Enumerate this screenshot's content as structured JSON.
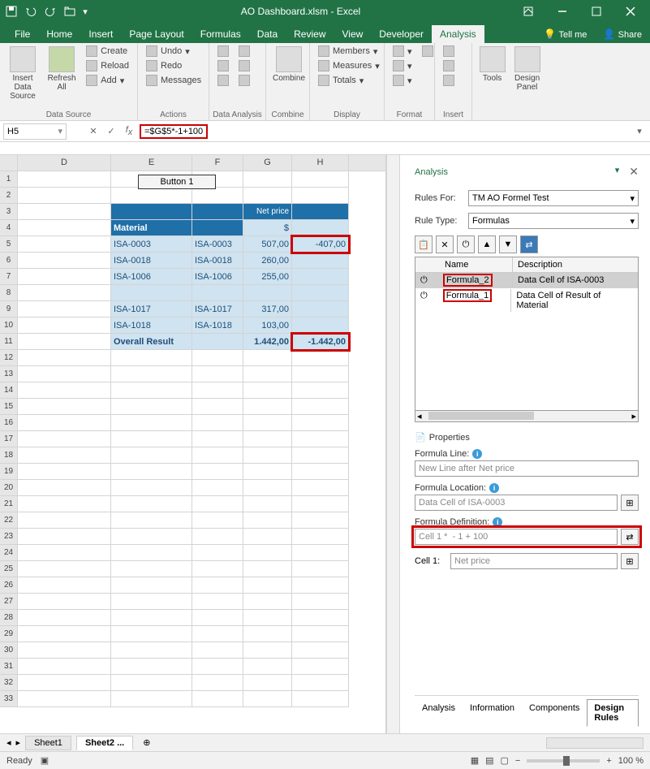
{
  "titlebar": {
    "title": "AO Dashboard.xlsm - Excel"
  },
  "tabs": {
    "file": "File",
    "home": "Home",
    "insert": "Insert",
    "pageLayout": "Page Layout",
    "formulas": "Formulas",
    "data": "Data",
    "review": "Review",
    "view": "View",
    "developer": "Developer",
    "analysis": "Analysis",
    "tellMe": "Tell me",
    "share": "Share"
  },
  "ribbon": {
    "dataSource": {
      "insertDataSource": "Insert Data Source",
      "refreshAll": "Refresh All",
      "create": "Create",
      "reload": "Reload",
      "add": "Add",
      "label": "Data Source"
    },
    "actions": {
      "undo": "Undo",
      "redo": "Redo",
      "messages": "Messages",
      "label": "Actions"
    },
    "dataAnalysis": {
      "label": "Data Analysis"
    },
    "combine": {
      "combine": "Combine",
      "label": "Combine"
    },
    "display": {
      "members": "Members",
      "measures": "Measures",
      "totals": "Totals",
      "label": "Display"
    },
    "format": {
      "label": "Format"
    },
    "insertG": {
      "label": "Insert"
    },
    "tools": {
      "tools": "Tools",
      "designPanel": "Design Panel"
    }
  },
  "formulaBar": {
    "nameBox": "H5",
    "formula": "=$G$5*-1+100"
  },
  "columns": {
    "D": "D",
    "E": "E",
    "F": "F",
    "G": "G",
    "H": "H"
  },
  "spreadsheet": {
    "button1": "Button 1",
    "netPrice": "Net price",
    "material": "Material",
    "dollar": "$",
    "rows": [
      {
        "e": "ISA-0003",
        "f": "ISA-0003",
        "g": "507,00",
        "h": "-407,00"
      },
      {
        "e": "ISA-0018",
        "f": "ISA-0018",
        "g": "260,00",
        "h": ""
      },
      {
        "e": "ISA-1006",
        "f": "ISA-1006",
        "g": "255,00",
        "h": ""
      },
      {
        "e": "",
        "f": "",
        "g": "",
        "h": ""
      },
      {
        "e": "ISA-1017",
        "f": "ISA-1017",
        "g": "317,00",
        "h": ""
      },
      {
        "e": "ISA-1018",
        "f": "ISA-1018",
        "g": "103,00",
        "h": ""
      }
    ],
    "overall": {
      "label": "Overall Result",
      "g": "1.442,00",
      "h": "-1.442,00"
    }
  },
  "panel": {
    "title": "Analysis",
    "rulesForLabel": "Rules For:",
    "rulesFor": "TM AO Formel Test",
    "ruleTypeLabel": "Rule Type:",
    "ruleType": "Formulas",
    "colName": "Name",
    "colDesc": "Description",
    "rules": [
      {
        "name": "Formula_2",
        "desc": "Data Cell of ISA-0003"
      },
      {
        "name": "Formula_1",
        "desc": "Data Cell of Result of Material"
      }
    ],
    "properties": "Properties",
    "formulaLine": "Formula Line:",
    "formulaLineVal": "New Line after Net price",
    "formulaLocation": "Formula Location:",
    "formulaLocationVal": "Data Cell of ISA-0003",
    "formulaDef": "Formula Definition:",
    "formulaDefVal": "Cell 1 *  - 1 + 100",
    "cell1Label": "Cell 1:",
    "cell1Val": "Net price",
    "tabs": {
      "analysis": "Analysis",
      "information": "Information",
      "components": "Components",
      "designRules": "Design Rules"
    }
  },
  "sheetTabs": {
    "sheet1": "Sheet1",
    "sheet2": "Sheet2 ..."
  },
  "statusBar": {
    "ready": "Ready",
    "zoom": "100 %"
  }
}
